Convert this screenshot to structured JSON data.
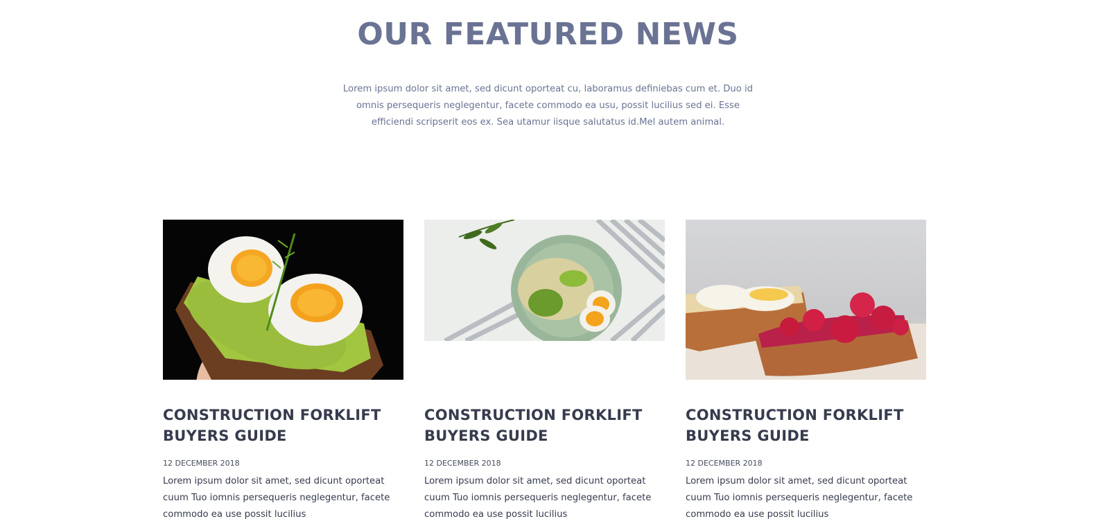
{
  "featured_news": {
    "title": "OUR FEATURED NEWS",
    "intro": "Lorem ipsum dolor sit amet, sed dicunt oporteat cu, laboramus definiebas cum et. Duo id omnis persequeris neglegentur, facete commodo ea usu, possit lucilius sed ei. Esse efficiendi scripserit eos ex. Sea utamur iisque salutatus id.Mel autem animal.",
    "articles": [
      {
        "title": "CONSTRUCTION FORKLIFT BUYERS GUIDE",
        "date": "12 DECEMBER 2018",
        "excerpt": "Lorem ipsum dolor sit amet, sed dicunt oporteat cuum Tuo iomnis persequeris neglegentur, facete commodo ea use possit lucilius"
      },
      {
        "title": "CONSTRUCTION FORKLIFT BUYERS GUIDE",
        "date": "12 DECEMBER 2018",
        "excerpt": "Lorem ipsum dolor sit amet, sed dicunt oporteat cuum Tuo iomnis persequeris neglegentur, facete commodo ea use possit lucilius"
      },
      {
        "title": "CONSTRUCTION FORKLIFT BUYERS GUIDE",
        "date": "12 DECEMBER 2018",
        "excerpt": "Lorem ipsum dolor sit amet, sed dicunt oporteat cuum Tuo iomnis persequeris neglegentur, facete commodo ea use possit lucilius"
      }
    ]
  },
  "colors": {
    "heading": "#6a7393",
    "card_title": "#363b4d",
    "body_text": "#363b4d"
  }
}
